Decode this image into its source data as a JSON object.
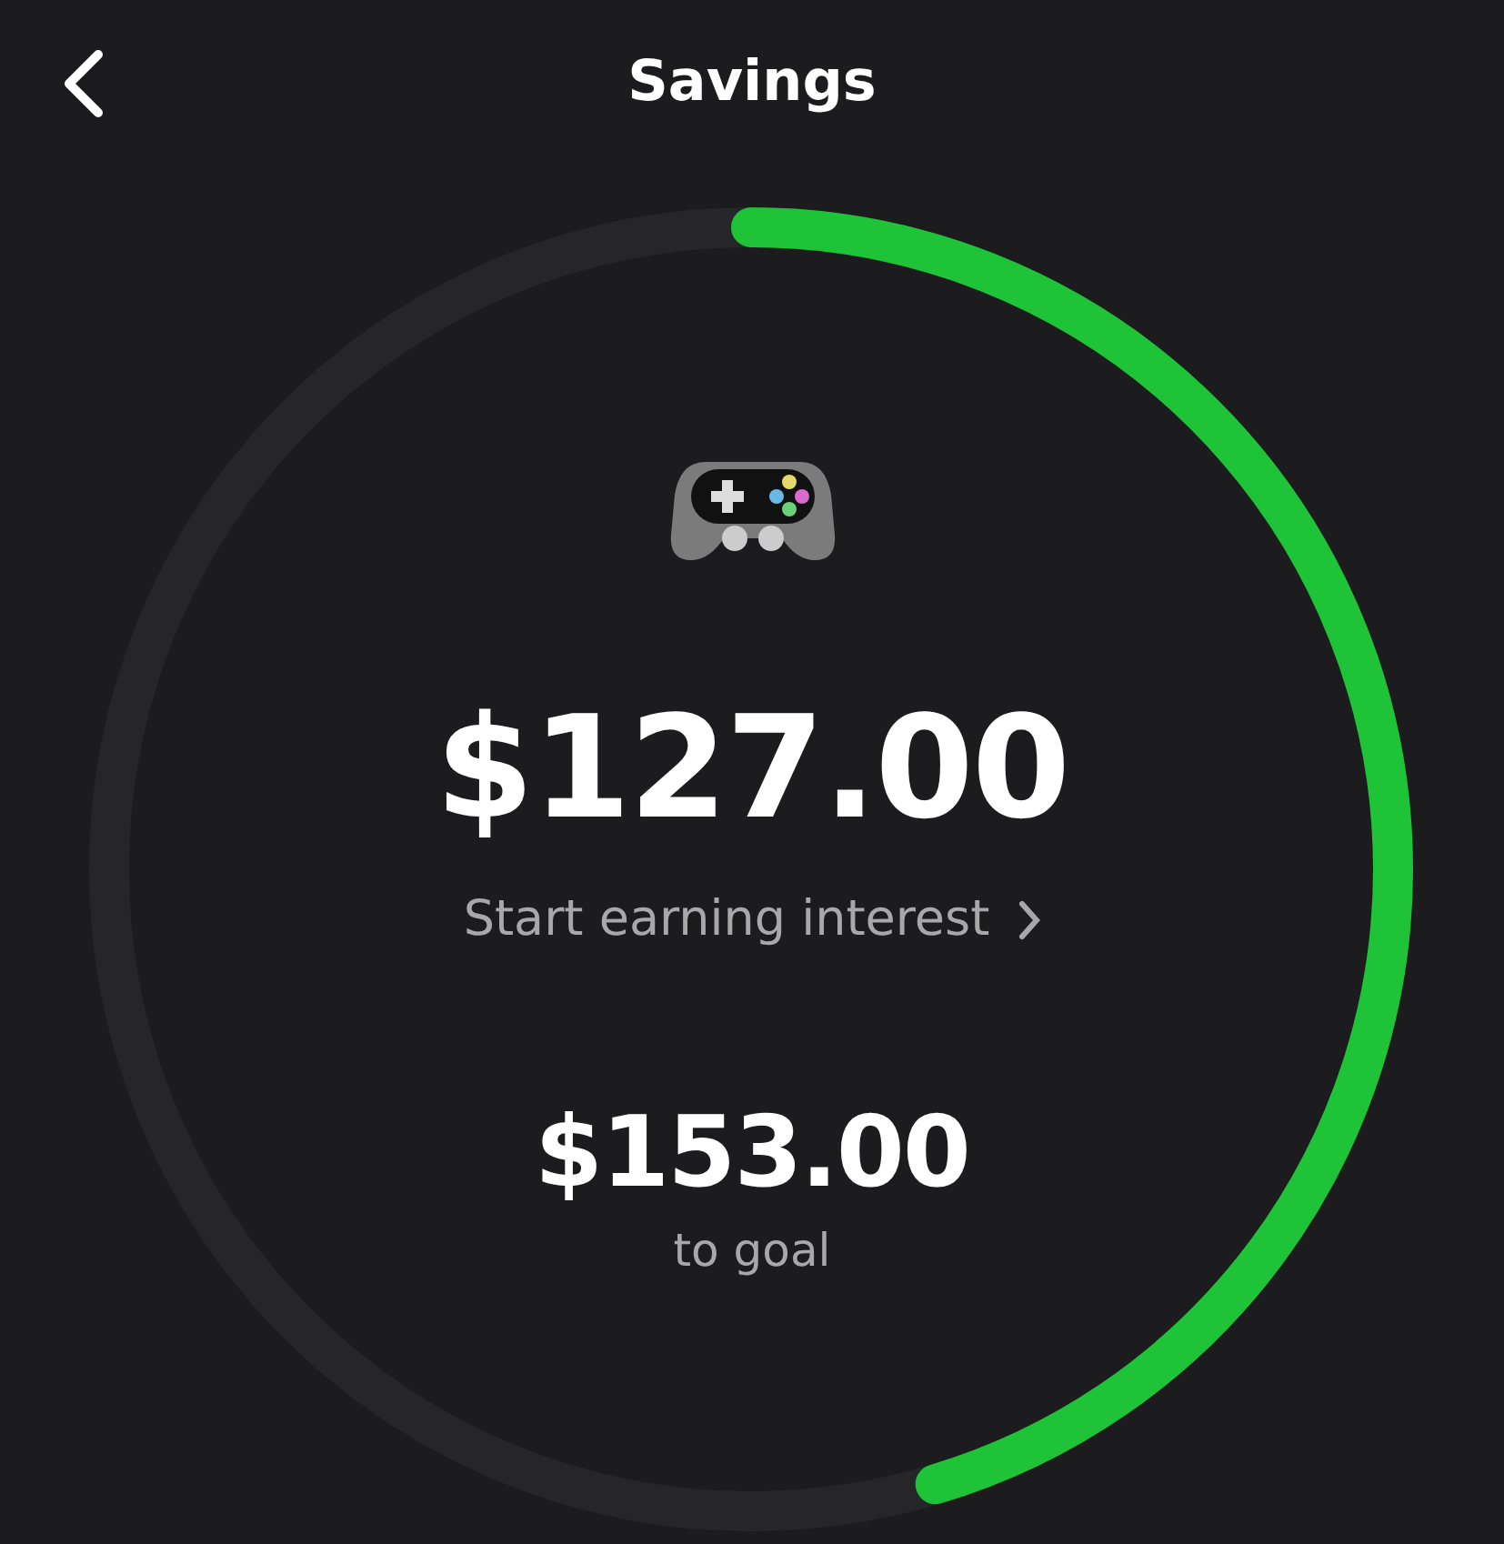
{
  "title": "Savings",
  "balance": "$127.00",
  "interest_link": "Start earning interest",
  "goal": {
    "remaining": "$153.00",
    "label": "to goal",
    "level": 0.4536
  }
}
